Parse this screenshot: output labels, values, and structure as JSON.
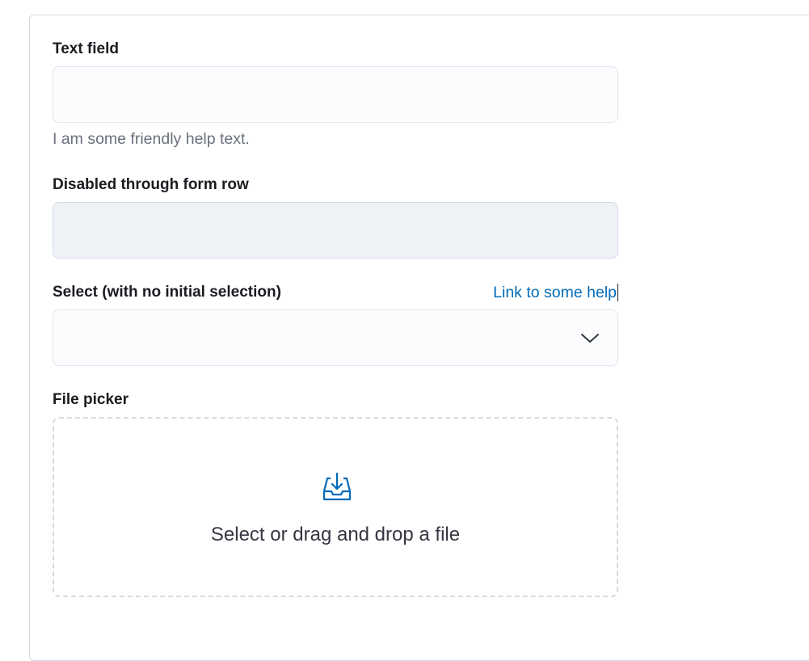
{
  "form": {
    "text_field": {
      "label": "Text field",
      "value": "",
      "help_text": "I am some friendly help text."
    },
    "disabled_field": {
      "label": "Disabled through form row",
      "value": ""
    },
    "select_field": {
      "label": "Select (with no initial selection)",
      "help_link": "Link to some help",
      "selected": ""
    },
    "file_picker": {
      "label": "File picker",
      "prompt": "Select or drag and drop a file"
    }
  },
  "icons": {
    "select_chevron": "chevron-down-icon",
    "file_picker": "inbox-download-icon"
  },
  "colors": {
    "link": "#006bb8",
    "border": "#d3dae6",
    "field_bg": "#fbfcfd",
    "disabled_bg": "#eef1f6",
    "help_text": "#69707d"
  }
}
